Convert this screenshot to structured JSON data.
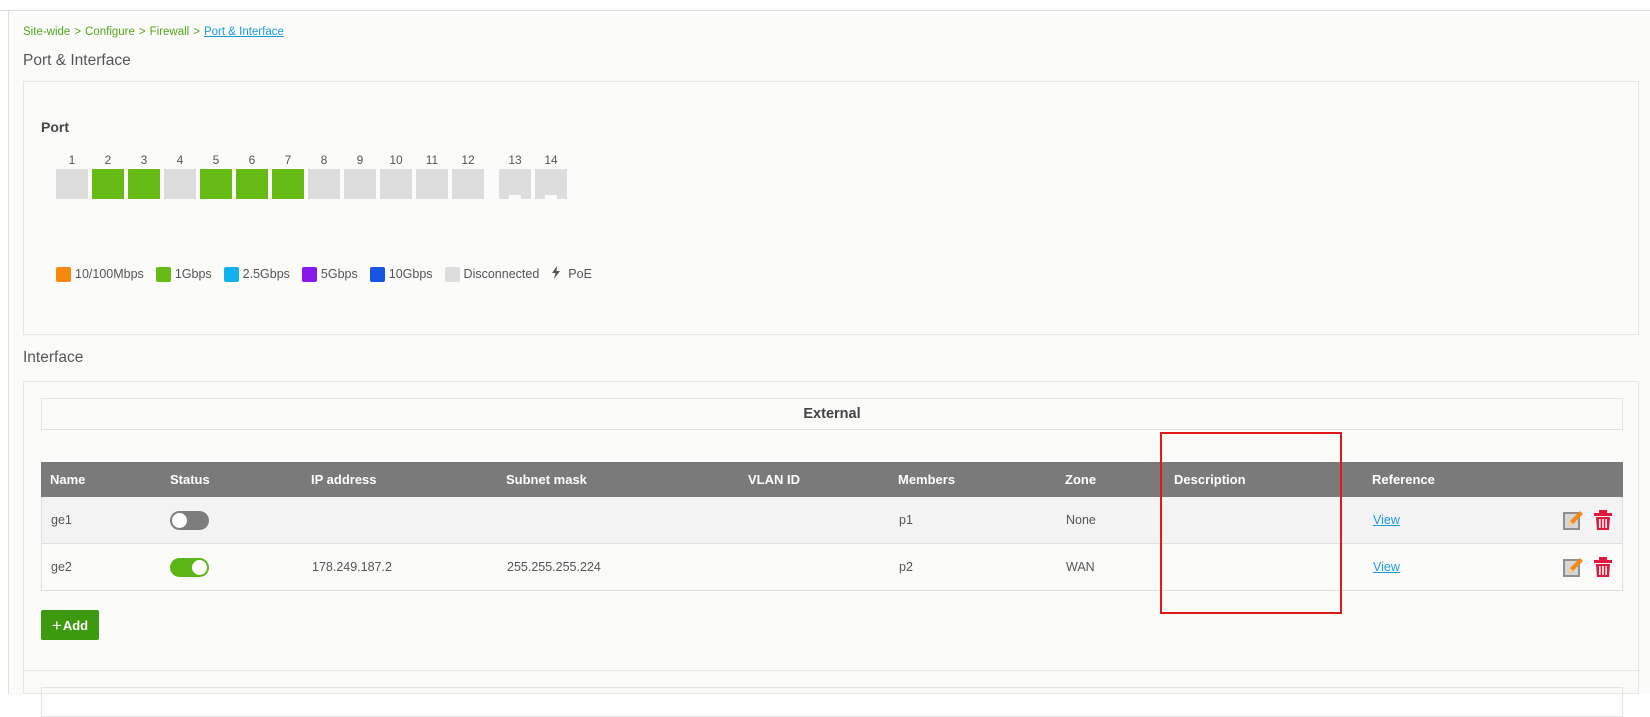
{
  "breadcrumb": {
    "items": [
      "Site-wide",
      "Configure",
      "Firewall"
    ],
    "separator": ">",
    "current": "Port & Interface"
  },
  "page_title": "Port & Interface",
  "port_section": {
    "heading": "Port",
    "ports": [
      {
        "label": "1",
        "speed": "disconnected"
      },
      {
        "label": "2",
        "speed": "1Gbps"
      },
      {
        "label": "3",
        "speed": "1Gbps"
      },
      {
        "label": "4",
        "speed": "disconnected"
      },
      {
        "label": "5",
        "speed": "1Gbps"
      },
      {
        "label": "6",
        "speed": "1Gbps"
      },
      {
        "label": "7",
        "speed": "1Gbps"
      },
      {
        "label": "8",
        "speed": "disconnected"
      },
      {
        "label": "9",
        "speed": "disconnected"
      },
      {
        "label": "10",
        "speed": "disconnected"
      },
      {
        "label": "11",
        "speed": "disconnected"
      },
      {
        "label": "12",
        "speed": "disconnected"
      },
      {
        "label": "13",
        "speed": "disconnected",
        "type": "sfp"
      },
      {
        "label": "14",
        "speed": "disconnected",
        "type": "sfp"
      }
    ],
    "legend": [
      {
        "label": "10/100Mbps",
        "color": "#f7870f"
      },
      {
        "label": "1Gbps",
        "color": "#66bb14"
      },
      {
        "label": "2.5Gbps",
        "color": "#13b1ef"
      },
      {
        "label": "5Gbps",
        "color": "#8a18e8"
      },
      {
        "label": "10Gbps",
        "color": "#1656e0"
      },
      {
        "label": "Disconnected",
        "color": "#dddddd"
      },
      {
        "label": "PoE",
        "icon": "lightning-icon"
      }
    ]
  },
  "interface_section": {
    "title": "Interface",
    "external_header": "External",
    "columns": [
      "Name",
      "Status",
      "IP address",
      "Subnet mask",
      "VLAN ID",
      "Members",
      "Zone",
      "Description",
      "Reference"
    ],
    "rows": [
      {
        "name": "ge1",
        "status": "off",
        "ip": "",
        "subnet": "",
        "vlan": "",
        "members": "p1",
        "zone": "None",
        "description": "",
        "reference": "View"
      },
      {
        "name": "ge2",
        "status": "on",
        "ip": "178.249.187.2",
        "subnet": "255.255.255.224",
        "vlan": "",
        "members": "p2",
        "zone": "WAN",
        "description": "",
        "reference": "View"
      }
    ],
    "add_label": "Add"
  },
  "colors": {
    "accent_green": "#66bb14",
    "add_button": "#3d9a0f",
    "table_header": "#7a7a7a",
    "link": "#1a9bdc",
    "highlight": "#e01a1a",
    "delete_icon": "#e0183c"
  },
  "icons": {
    "edit": "edit-icon",
    "delete": "trash-icon",
    "poe": "lightning-icon"
  }
}
